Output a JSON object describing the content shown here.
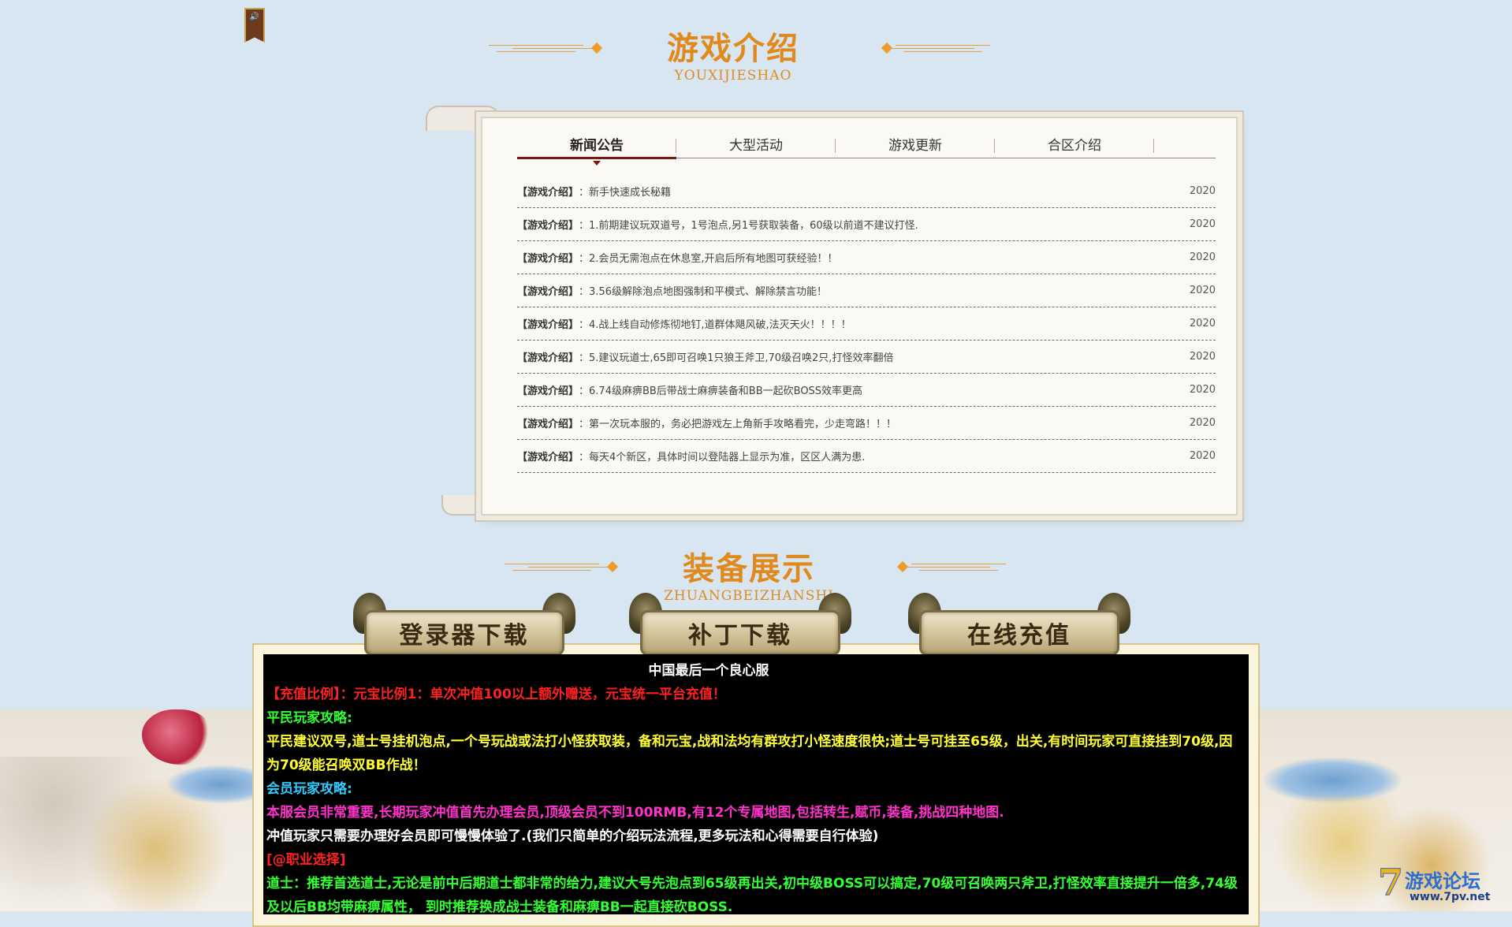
{
  "header_intro": {
    "title": "游戏介绍",
    "pinyin": "YOUXIJIESHAO"
  },
  "header_equip": {
    "title": "装备展示",
    "pinyin": "ZHUANGBEIZHANSHI"
  },
  "tabs": [
    {
      "label": "新闻公告",
      "active": true
    },
    {
      "label": "大型活动",
      "active": false
    },
    {
      "label": "游戏更新",
      "active": false
    },
    {
      "label": "合区介绍",
      "active": false
    }
  ],
  "news": [
    {
      "category": "【游戏介绍】",
      "text": "：新手快速成长秘籍",
      "date": "2020"
    },
    {
      "category": "【游戏介绍】",
      "text": "：1.前期建议玩双道号，1号泡点,另1号获取装备，60级以前道不建议打怪.",
      "date": "2020"
    },
    {
      "category": "【游戏介绍】",
      "text": "：2.会员无需泡点在休息室,开启后所有地图可获经验！！",
      "date": "2020"
    },
    {
      "category": "【游戏介绍】",
      "text": "：3.56级解除泡点地图强制和平模式、解除禁言功能！",
      "date": "2020"
    },
    {
      "category": "【游戏介绍】",
      "text": "：4.战上线自动修炼彻地钉,道群体飓风破,法灭天火！！！！",
      "date": "2020"
    },
    {
      "category": "【游戏介绍】",
      "text": "：5.建议玩道士,65即可召唤1只狼王斧卫,70级召唤2只,打怪效率翻倍",
      "date": "2020"
    },
    {
      "category": "【游戏介绍】",
      "text": "：6.74级麻痹BB后带战士麻痹装备和BB一起砍BOSS效率更高",
      "date": "2020"
    },
    {
      "category": "【游戏介绍】",
      "text": "：第一次玩本服的，务必把游戏左上角新手攻略看完，少走弯路！！！",
      "date": "2020"
    },
    {
      "category": "【游戏介绍】",
      "text": "：每天4个新区，具体时间以登陆器上显示为准，区区人满为患.",
      "date": "2020"
    }
  ],
  "buttons": {
    "launcher": "登录器下载",
    "patch": "补丁下载",
    "recharge": "在线充值"
  },
  "info": {
    "title": "中国最后一个良心服",
    "line1": "【充值比例】：元宝比例1：单次冲值100以上额外赠送，元宝统一平台充值！",
    "line2": "平民玩家攻略:",
    "line3": "平民建议双号,道士号挂机泡点,一个号玩战或法打小怪获取装，备和元宝,战和法均有群攻打小怪速度很快;道士号可挂至65级，出关,有时间玩家可直接挂到70级,因为70级能召唤双BB作战！",
    "line4": "会员玩家攻略:",
    "line5": "本服会员非常重要,长期玩家冲值首先办理会员,顶级会员不到100RMB,有12个专属地图,包括转生,赋币,装备,挑战四种地图.",
    "line6": "冲值玩家只需要办理好会员即可慢慢体验了.(我们只简单的介绍玩法流程,更多玩法和心得需要自行体验)",
    "line7": "[@职业选择]",
    "line8": "道士：推荐首选道士,无论是前中后期道士都非常的给力,建议大号先泡点到65级再出关,初中级BOSS可以搞定,70级可召唤两只斧卫,打怪效率直接提升一倍多,74级及以后BB均带麻痹属性， 到时推荐换成战士装备和麻痹BB一起直接砍BOSS."
  },
  "watermark": {
    "num": "7",
    "name": "游戏论坛",
    "url": "www.7pv.net"
  },
  "colors": {
    "background": "#d8e6f2",
    "title_orange": "#e08a1e",
    "tab_underline": "#7a1b13"
  }
}
